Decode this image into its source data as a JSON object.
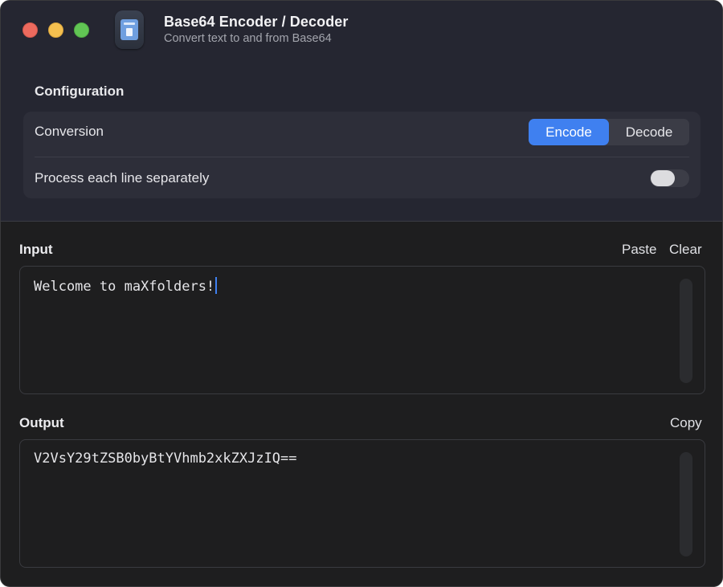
{
  "window": {
    "title": "Base64 Encoder / Decoder",
    "subtitle": "Convert text to and from Base64"
  },
  "config": {
    "section_title": "Configuration",
    "conversion_label": "Conversion",
    "encode_label": "Encode",
    "decode_label": "Decode",
    "selected_mode": "Encode",
    "line_label": "Process each line separately",
    "line_toggle_on": false
  },
  "input": {
    "title": "Input",
    "paste_label": "Paste",
    "clear_label": "Clear",
    "value": "Welcome to maXfolders!"
  },
  "output": {
    "title": "Output",
    "copy_label": "Copy",
    "value": "V2VsY29tZSB0byBtYVhmb2xkZXJzIQ=="
  },
  "icons": {
    "close": "close-traffic-light-icon",
    "minimize": "minimize-traffic-light-icon",
    "maximize": "maximize-traffic-light-icon",
    "app": "base64-app-icon"
  },
  "colors": {
    "accent": "#3f80f0",
    "close": "#ed6a5e",
    "minimize": "#f4bf4f",
    "maximize": "#61c554"
  }
}
